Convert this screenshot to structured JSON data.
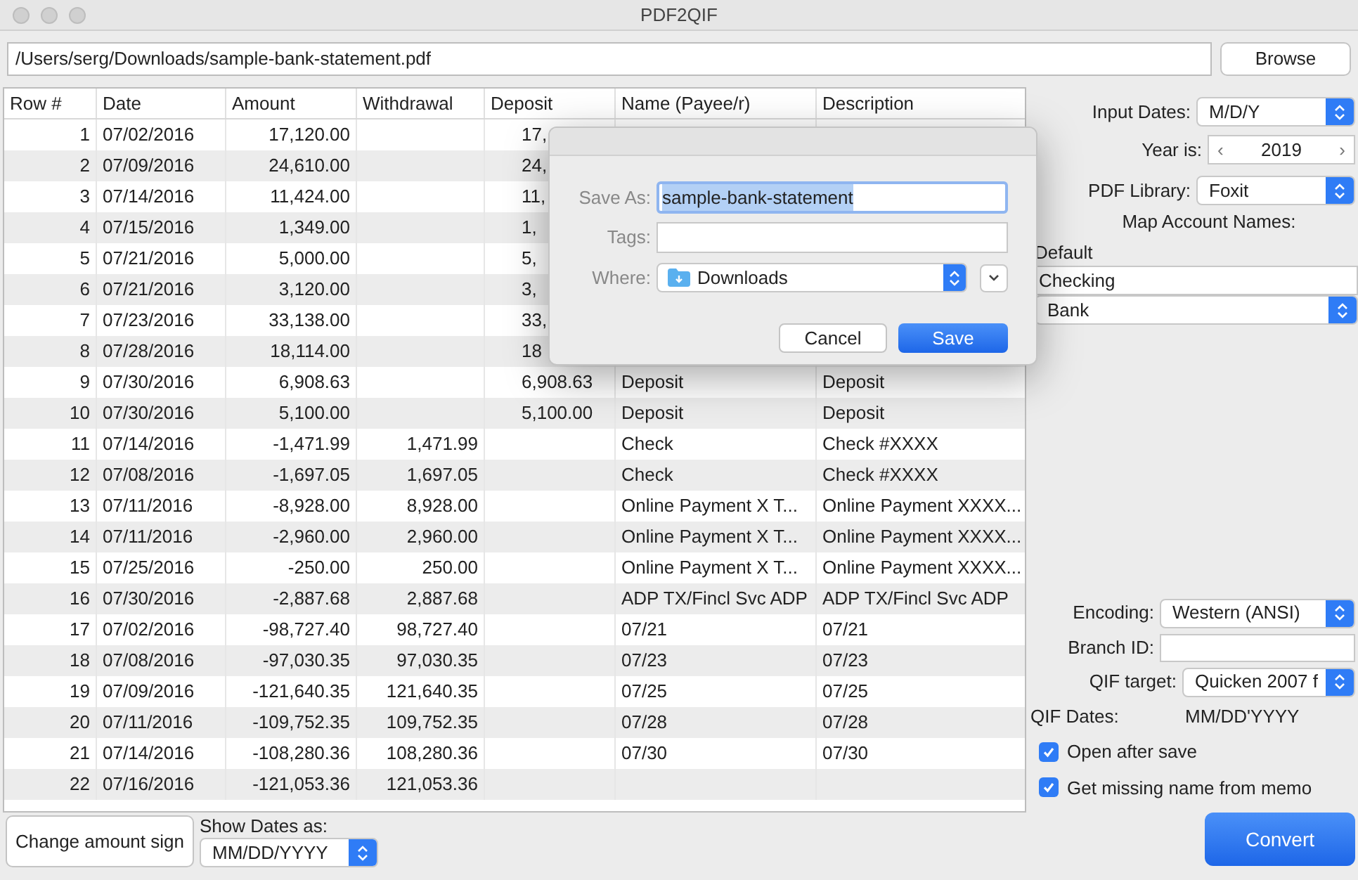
{
  "window": {
    "title": "PDF2QIF"
  },
  "file_path": "/Users/serg/Downloads/sample-bank-statement.pdf",
  "browse_button": "Browse",
  "table": {
    "columns": [
      "Row #",
      "Date",
      "Amount",
      "Withdrawal",
      "Deposit",
      "Name (Payee/r)",
      "Description"
    ],
    "rows": [
      {
        "row": "1",
        "date": "07/02/2016",
        "amount": "17,120.00",
        "deposit": "17,"
      },
      {
        "row": "2",
        "date": "07/09/2016",
        "amount": "24,610.00",
        "deposit": "24,"
      },
      {
        "row": "3",
        "date": "07/14/2016",
        "amount": "11,424.00",
        "deposit": "11,"
      },
      {
        "row": "4",
        "date": "07/15/2016",
        "amount": "1,349.00",
        "deposit": "1,"
      },
      {
        "row": "5",
        "date": "07/21/2016",
        "amount": "5,000.00",
        "deposit": "5,"
      },
      {
        "row": "6",
        "date": "07/21/2016",
        "amount": "3,120.00",
        "deposit": "3,"
      },
      {
        "row": "7",
        "date": "07/23/2016",
        "amount": "33,138.00",
        "deposit": "33,"
      },
      {
        "row": "8",
        "date": "07/28/2016",
        "amount": "18,114.00",
        "deposit": "18"
      },
      {
        "row": "9",
        "date": "07/30/2016",
        "amount": "6,908.63",
        "deposit": "6,908.63",
        "name": "Deposit",
        "description": "Deposit"
      },
      {
        "row": "10",
        "date": "07/30/2016",
        "amount": "5,100.00",
        "deposit": "5,100.00",
        "name": "Deposit",
        "description": "Deposit"
      },
      {
        "row": "11",
        "date": "07/14/2016",
        "amount": "-1,471.99",
        "withdrawal": "1,471.99",
        "name": "Check",
        "description": "Check #XXXX"
      },
      {
        "row": "12",
        "date": "07/08/2016",
        "amount": "-1,697.05",
        "withdrawal": "1,697.05",
        "name": "Check",
        "description": "Check #XXXX"
      },
      {
        "row": "13",
        "date": "07/11/2016",
        "amount": "-8,928.00",
        "withdrawal": "8,928.00",
        "name": "Online Payment X T...",
        "description": "Online Payment XXXX..."
      },
      {
        "row": "14",
        "date": "07/11/2016",
        "amount": "-2,960.00",
        "withdrawal": "2,960.00",
        "name": "Online Payment X T...",
        "description": "Online Payment XXXX..."
      },
      {
        "row": "15",
        "date": "07/25/2016",
        "amount": "-250.00",
        "withdrawal": "250.00",
        "name": "Online Payment X T...",
        "description": "Online Payment XXXX..."
      },
      {
        "row": "16",
        "date": "07/30/2016",
        "amount": "-2,887.68",
        "withdrawal": "2,887.68",
        "name": "ADP TX/Fincl Svc ADP",
        "description": "ADP TX/Fincl Svc ADP"
      },
      {
        "row": "17",
        "date": "07/02/2016",
        "amount": "-98,727.40",
        "withdrawal": "98,727.40",
        "name": "07/21",
        "description": "07/21"
      },
      {
        "row": "18",
        "date": "07/08/2016",
        "amount": "-97,030.35",
        "withdrawal": "97,030.35",
        "name": "07/23",
        "description": "07/23"
      },
      {
        "row": "19",
        "date": "07/09/2016",
        "amount": "-121,640.35",
        "withdrawal": "121,640.35",
        "name": "07/25",
        "description": "07/25"
      },
      {
        "row": "20",
        "date": "07/11/2016",
        "amount": "-109,752.35",
        "withdrawal": "109,752.35",
        "name": "07/28",
        "description": "07/28"
      },
      {
        "row": "21",
        "date": "07/14/2016",
        "amount": "-108,280.36",
        "withdrawal": "108,280.36",
        "name": "07/30",
        "description": "07/30"
      },
      {
        "row": "22",
        "date": "07/16/2016",
        "amount": "-121,053.36",
        "withdrawal": "121,053.36"
      }
    ]
  },
  "save_dialog": {
    "save_as_label": "Save As:",
    "save_as_value": "sample-bank-statement",
    "tags_label": "Tags:",
    "where_label": "Where:",
    "where_value": "Downloads",
    "cancel_button": "Cancel",
    "save_button": "Save"
  },
  "settings": {
    "input_dates_label": "Input Dates:",
    "input_dates_value": "M/D/Y",
    "year_label": "Year is:",
    "year_prev": "‹",
    "year_value": "2019",
    "year_next": "›",
    "pdf_library_label": "PDF Library:",
    "pdf_library_value": "Foxit",
    "map_account_names": "Map Account Names:",
    "default_label": "Default",
    "account_name_value": "Checking",
    "account_type_value": "Bank",
    "encoding_label": "Encoding:",
    "encoding_value": "Western (ANSI)",
    "branch_id_label": "Branch ID:",
    "qif_target_label": "QIF target:",
    "qif_target_value": "Quicken 2007 f",
    "qif_dates_label": "QIF Dates:",
    "qif_dates_value": "MM/DD'YYYY",
    "checkboxes": [
      {
        "label": "Open after save",
        "checked": true
      },
      {
        "label": "Get missing name from memo",
        "checked": true
      }
    ]
  },
  "convert_button": "Convert",
  "change_sign_button": "Change amount sign",
  "show_dates_label": "Show Dates as:",
  "show_dates_value": "MM/DD/YYYY"
}
